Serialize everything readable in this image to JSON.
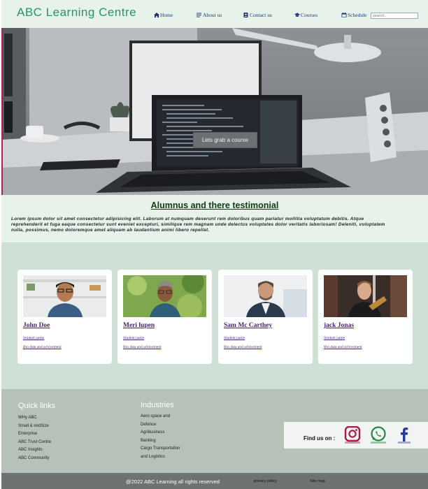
{
  "header": {
    "brand": "ABC Learning Centre",
    "nav": {
      "home": "Home",
      "about": "About us",
      "contact": "Contact us",
      "courses": "Courses",
      "schedule": "Schedule"
    },
    "search_placeholder": "search.."
  },
  "hero": {
    "cta_label": "Lets grab a course"
  },
  "testimonial": {
    "title": "Alumnus and there testimonial",
    "body": "Lorem ipsum dolor sit amet consectetur adipisicing elit. Laborum at numquam deserunt rem doloribus quam pariatur mollitia voluptatum debitis. Atque reprehenderit et fuga eaque consectetur sunt eveniet excepturi, similique rem magnam unde delectus voluptates dolor veritatis laboriosam! Deleniti, voluptatem nulla, possimus, nemo doloremque amet aliquam ab laudantium animi libero repellat."
  },
  "alumni": [
    {
      "name": "John Doe",
      "role": "Student name",
      "bio": "Bio data and achivement"
    },
    {
      "name": "Meri lupen",
      "role": "Student name",
      "bio": "Bio data and achivement"
    },
    {
      "name": "Sam Mc Carthey",
      "role": "Student name",
      "bio": "Bio data and achivement"
    },
    {
      "name": "jack Jonas",
      "role": "Student name",
      "bio": "Bio data and achivement"
    }
  ],
  "footer": {
    "quick_links_title": "Quick links",
    "quick_links": [
      "WHy ABC",
      "Small & midSize",
      "Enterprise",
      "ABC Trust Centre",
      "ABC Insights",
      "ABC Community"
    ],
    "industries_title": "Industries",
    "industries": [
      "Aero space and",
      "Defence",
      "Agribusiness",
      "Banking",
      "Cargo Transportation",
      "and Logistics"
    ],
    "find_us_label": "Find us on :",
    "copyright": "@2022 ABC Learning all rights reserved",
    "privacy": "privacy policy",
    "sitemap": "Site map"
  },
  "colors": {
    "brand_green": "#1f9a63",
    "header_bg": "#e6f2ea",
    "cards_bg": "#cfe0d4",
    "footer_bg": "#b5c1b9",
    "bottom_bar": "#6d7470",
    "link_purple": "#4a1f7a"
  }
}
